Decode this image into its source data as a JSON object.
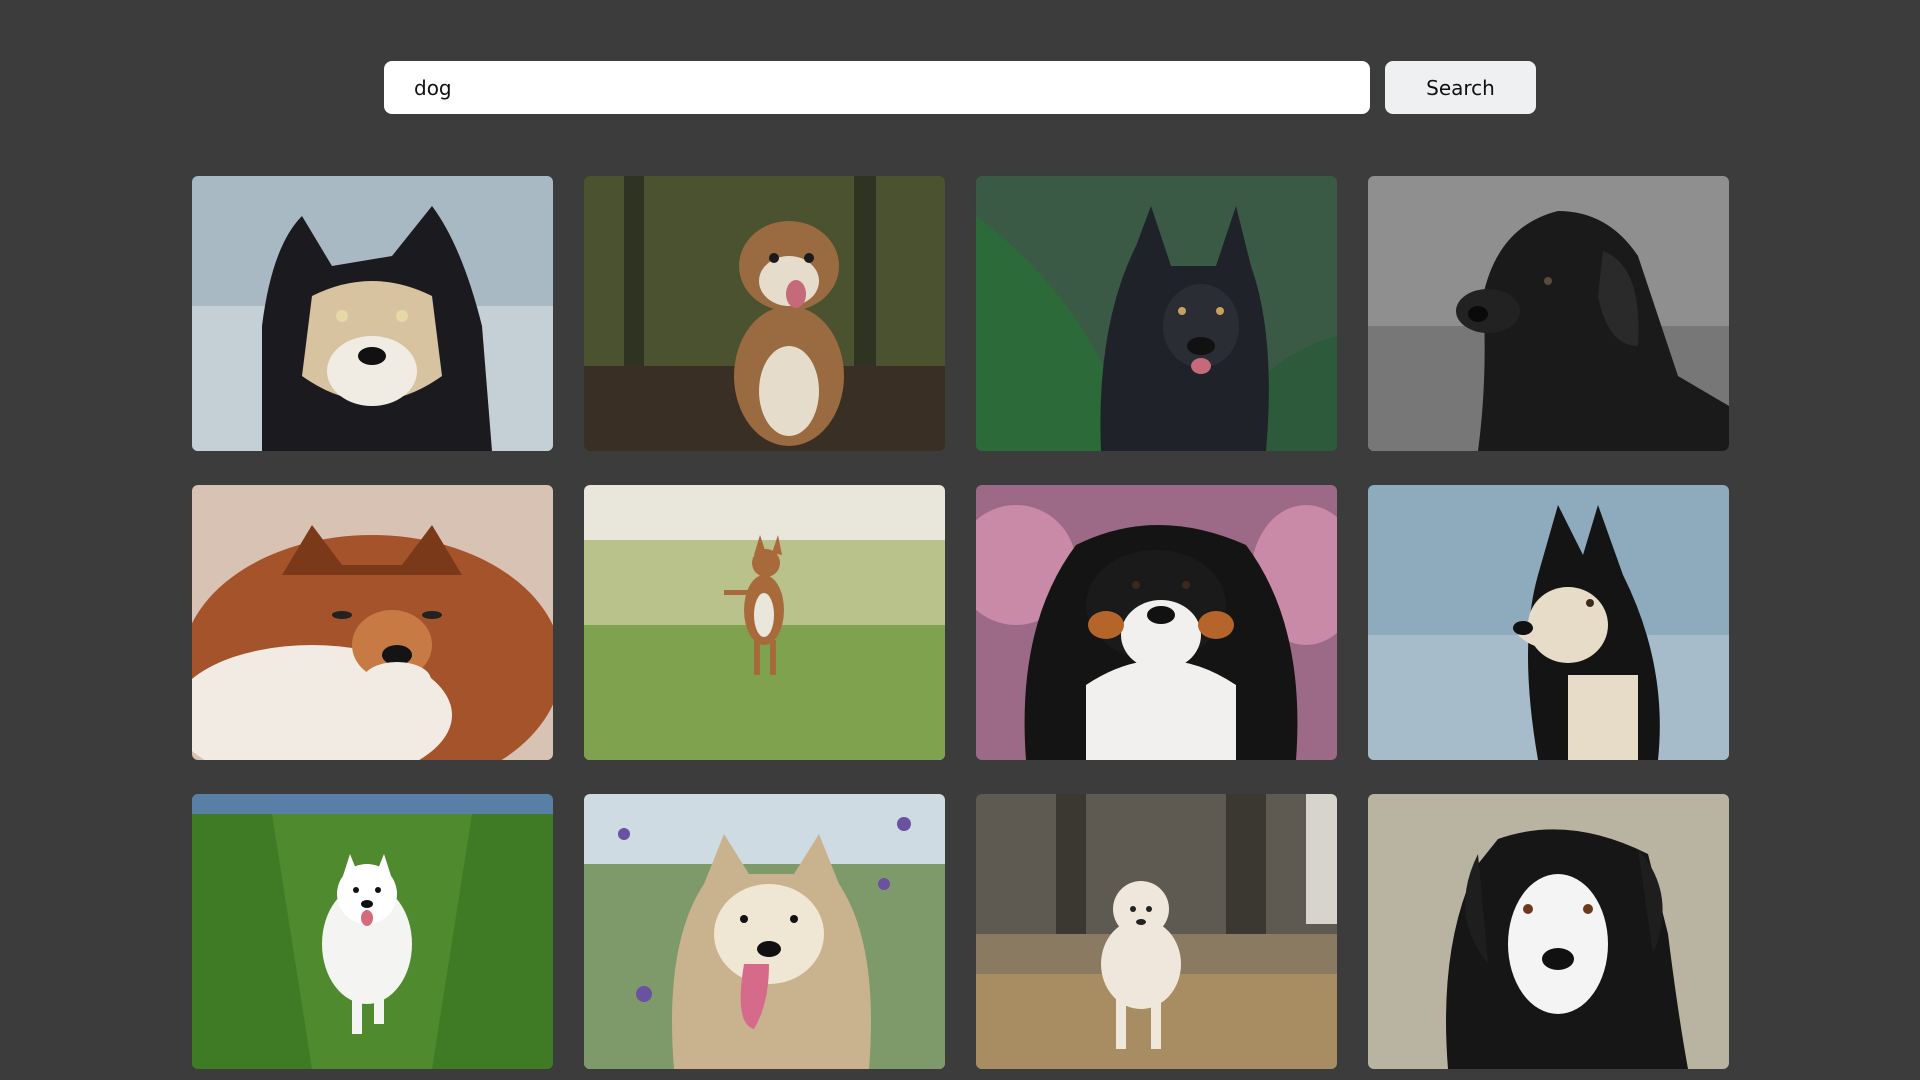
{
  "search": {
    "query": "dog",
    "button_label": "Search"
  },
  "results": [
    {
      "subject": "husky-black-tan-face",
      "background": "#a8b9c4",
      "accent": "#1b1b1f",
      "light": "#d8c3a0"
    },
    {
      "subject": "english-bulldog-walking-forest",
      "background": "#4a5230",
      "accent": "#9a6a40",
      "light": "#e6dccb"
    },
    {
      "subject": "akita-in-pine-branches",
      "background": "#3b5a45",
      "accent": "#1f2228",
      "light": "#c7c0b8"
    },
    {
      "subject": "black-labrador-grayscale",
      "background": "#8f8f8f",
      "accent": "#1a1a1a",
      "light": "#5a5a5a"
    },
    {
      "subject": "sheltie-close-up",
      "background": "#d8c2b4",
      "accent": "#a5532a",
      "light": "#f1ebe4"
    },
    {
      "subject": "basenji-standing-in-grass",
      "background": "#b8c28a",
      "accent": "#a86a3a",
      "light": "#e9e6dc"
    },
    {
      "subject": "bernese-mountain-dog-blossoms",
      "background": "#9c6a86",
      "accent": "#141414",
      "light": "#f2f0ee"
    },
    {
      "subject": "husky-puppy-by-water",
      "background": "#8eaabd",
      "accent": "#141414",
      "light": "#e7dcc8"
    },
    {
      "subject": "samoyed-running-in-wheat",
      "background": "#4f8b2e",
      "accent": "#f4f4f2",
      "light": "#ffffff"
    },
    {
      "subject": "eurasier-in-wildflowers",
      "background": "#7e9a6a",
      "accent": "#c9b38e",
      "light": "#efe6d4"
    },
    {
      "subject": "white-poodle-in-dry-grass",
      "background": "#8a7a62",
      "accent": "#efe7dc",
      "light": "#ffffff"
    },
    {
      "subject": "black-white-dog-portrait",
      "background": "#b9b4a2",
      "accent": "#161616",
      "light": "#f4f4f4"
    }
  ]
}
